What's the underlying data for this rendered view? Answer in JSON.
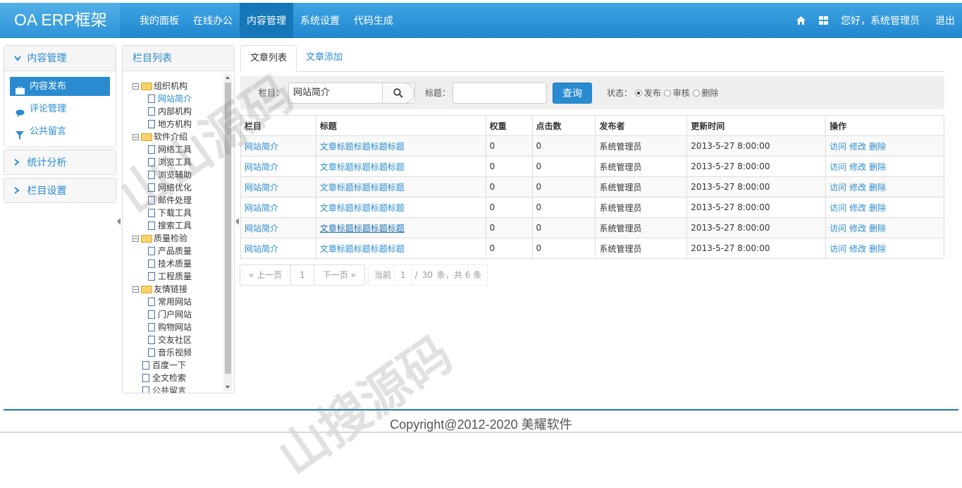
{
  "app": {
    "brand": "OA ERP框架"
  },
  "nav": [
    {
      "label": "我的面板"
    },
    {
      "label": "在线办公"
    },
    {
      "label": "内容管理",
      "active": true
    },
    {
      "label": "系统设置"
    },
    {
      "label": "代码生成"
    }
  ],
  "topright": {
    "greeting": "您好，系统管理员",
    "logout": "退出",
    "home_icon": "home-icon",
    "apps_icon": "grid-icon"
  },
  "sidebar": {
    "section_title": "内容管理",
    "items": [
      {
        "label": "内容发布",
        "icon": "briefcase-icon",
        "active": true
      },
      {
        "label": "评论管理",
        "icon": "comment-icon"
      },
      {
        "label": "公共留言",
        "icon": "filter-icon"
      }
    ],
    "groups": [
      {
        "label": "统计分析"
      },
      {
        "label": "栏目设置"
      }
    ]
  },
  "tree": {
    "title": "栏目列表",
    "nodes": [
      {
        "label": "组织机构",
        "folder": true,
        "children": [
          "网站简介",
          "内部机构",
          "地方机构"
        ]
      },
      {
        "label": "软件介绍",
        "folder": true,
        "children": [
          "网络工具",
          "浏览工具",
          "浏览辅助",
          "网络优化",
          "邮件处理",
          "下载工具",
          "搜索工具"
        ]
      },
      {
        "label": "质量检验",
        "folder": true,
        "children": [
          "产品质量",
          "技术质量",
          "工程质量"
        ]
      },
      {
        "label": "友情链接",
        "folder": true,
        "children": [
          "常用网站",
          "门户网站",
          "购物网站",
          "交友社区",
          "音乐视频"
        ]
      },
      {
        "label": "百度一下",
        "folder": false
      },
      {
        "label": "全文检索",
        "folder": false
      },
      {
        "label": "公共留言",
        "folder": false
      }
    ],
    "selected": "网站简介"
  },
  "tabs": [
    {
      "label": "文章列表",
      "active": true
    },
    {
      "label": "文章添加"
    }
  ],
  "search": {
    "column_label": "栏目：",
    "column_value": "网站简介",
    "title_label": "标题：",
    "title_value": "",
    "query_button": "查询",
    "status_label": "状态：",
    "status_options": [
      {
        "label": "发布",
        "checked": true
      },
      {
        "label": "审核"
      },
      {
        "label": "删除"
      }
    ]
  },
  "table": {
    "columns": [
      "栏目",
      "标题",
      "权重",
      "点击数",
      "发布者",
      "更新时间",
      "操作"
    ],
    "rows": [
      {
        "column": "网站简介",
        "title": "文章标题标题标题标题",
        "weight": "0",
        "clicks": "0",
        "publisher": "系统管理员",
        "updated": "2013-5-27 8:00:00"
      },
      {
        "column": "网站简介",
        "title": "文章标题标题标题标题",
        "weight": "0",
        "clicks": "0",
        "publisher": "系统管理员",
        "updated": "2013-5-27 8:00:00"
      },
      {
        "column": "网站简介",
        "title": "文章标题标题标题标题",
        "weight": "0",
        "clicks": "0",
        "publisher": "系统管理员",
        "updated": "2013-5-27 8:00:00"
      },
      {
        "column": "网站简介",
        "title": "文章标题标题标题标题",
        "weight": "0",
        "clicks": "0",
        "publisher": "系统管理员",
        "updated": "2013-5-27 8:00:00"
      },
      {
        "column": "网站简介",
        "title": "文章标题标题标题标题",
        "weight": "0",
        "clicks": "0",
        "publisher": "系统管理员",
        "updated": "2013-5-27 8:00:00",
        "hover": true
      },
      {
        "column": "网站简介",
        "title": "文章标题标题标题标题",
        "weight": "0",
        "clicks": "0",
        "publisher": "系统管理员",
        "updated": "2013-5-27 8:00:00"
      }
    ],
    "actions": [
      "访问",
      "修改",
      "删除"
    ]
  },
  "pager": {
    "prev": "« 上一页",
    "page": "1",
    "next": "下一页 »",
    "current_label": "当前",
    "current": "1",
    "sep": "/",
    "total_pages": "30",
    "suffix": "条，共 6 条"
  },
  "footer": {
    "copyright": "Copyright@2012-2020 美耀软件"
  },
  "watermark": {
    "text1": "山山源码",
    "text2": "山搜源码"
  }
}
